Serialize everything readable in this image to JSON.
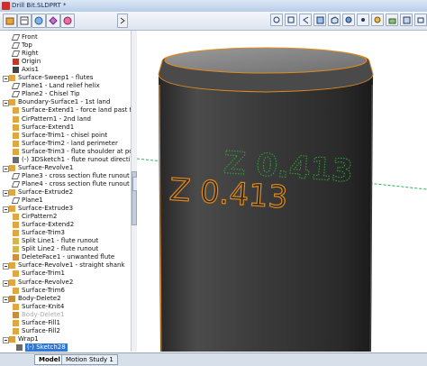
{
  "window": {
    "title": "Drill Bit.SLDPRT *"
  },
  "tree": {
    "items": [
      {
        "label": "Front",
        "icon": "plane-icon",
        "kind": "plane",
        "indent": 1
      },
      {
        "label": "Top",
        "icon": "plane-icon",
        "kind": "plane",
        "indent": 1
      },
      {
        "label": "Right",
        "icon": "plane-icon",
        "kind": "plane",
        "indent": 1
      },
      {
        "label": "Origin",
        "icon": "origin-icon",
        "kind": "origin",
        "indent": 1
      },
      {
        "label": "Axis1",
        "icon": "axis-icon",
        "kind": "axis",
        "indent": 1
      },
      {
        "label": "Surface-Sweep1 - flutes",
        "icon": "surface-feature-icon",
        "kind": "surface",
        "indent": 0,
        "exp": true
      },
      {
        "label": "Plane1 - Land relief helix",
        "icon": "plane-icon",
        "kind": "plane",
        "indent": 1
      },
      {
        "label": "Plane2 - Chisel Tip",
        "icon": "plane-icon",
        "kind": "plane",
        "indent": 1
      },
      {
        "label": "Boundary-Surface1 - 1st land",
        "icon": "surface-feature-icon",
        "kind": "surface",
        "indent": 0,
        "exp": true
      },
      {
        "label": "Surface-Extend1 - force land past flute",
        "icon": "surface-feature-icon",
        "kind": "surface",
        "indent": 1
      },
      {
        "label": "CirPattern1 - 2nd land",
        "icon": "pattern-icon",
        "kind": "pattern",
        "indent": 1
      },
      {
        "label": "Surface-Extend1",
        "icon": "surface-feature-icon",
        "kind": "surface",
        "indent": 1
      },
      {
        "label": "Surface-Trim1 - chisel point",
        "icon": "surface-feature-icon",
        "kind": "surface",
        "indent": 1
      },
      {
        "label": "Surface-Trim2 - land perimeter",
        "icon": "surface-feature-icon",
        "kind": "surface",
        "indent": 1
      },
      {
        "label": "Surface-Trim3 - flute shoulder at point",
        "icon": "surface-feature-icon",
        "kind": "surface",
        "indent": 1
      },
      {
        "label": "(-) 3DSketch1 - flute runout direction",
        "icon": "sketch-icon",
        "kind": "sketch",
        "indent": 1
      },
      {
        "label": "Surface-Revolve1",
        "icon": "surface-feature-icon",
        "kind": "surface",
        "indent": 0,
        "exp": true
      },
      {
        "label": "Plane3 - cross section flute runout",
        "icon": "plane-icon",
        "kind": "plane",
        "indent": 1
      },
      {
        "label": "Plane4 - cross section flute runout",
        "icon": "plane-icon",
        "kind": "plane",
        "indent": 1
      },
      {
        "label": "Surface-Extrude2",
        "icon": "surface-feature-icon",
        "kind": "surface",
        "indent": 0,
        "exp": true
      },
      {
        "label": "Plane1",
        "icon": "plane-icon",
        "kind": "plane",
        "indent": 1
      },
      {
        "label": "Surface-Extrude3",
        "icon": "surface-feature-icon",
        "kind": "surface",
        "indent": 0,
        "exp": true
      },
      {
        "label": "CirPattern2",
        "icon": "pattern-icon",
        "kind": "pattern",
        "indent": 1
      },
      {
        "label": "Surface-Extend2",
        "icon": "surface-feature-icon",
        "kind": "surface",
        "indent": 1
      },
      {
        "label": "Surface-Trim3",
        "icon": "surface-feature-icon",
        "kind": "surface",
        "indent": 1
      },
      {
        "label": "Split Line1 - flute runout",
        "icon": "split-line-icon",
        "kind": "split",
        "indent": 1
      },
      {
        "label": "Split Line2 - flute runout",
        "icon": "split-line-icon",
        "kind": "split",
        "indent": 1
      },
      {
        "label": "DeleteFace1 - unwanted flute",
        "icon": "delete-face-icon",
        "kind": "face",
        "indent": 1
      },
      {
        "label": "Surface-Revolve1 - straight shank",
        "icon": "surface-feature-icon",
        "kind": "surface",
        "indent": 0,
        "exp": true
      },
      {
        "label": "Surface-Trim1",
        "icon": "surface-feature-icon",
        "kind": "surface",
        "indent": 1
      },
      {
        "label": "Surface-Revolve2",
        "icon": "surface-feature-icon",
        "kind": "surface",
        "indent": 0,
        "exp": true
      },
      {
        "label": "Surface-Trim6",
        "icon": "surface-feature-icon",
        "kind": "surface",
        "indent": 1
      },
      {
        "label": "Body-Delete2",
        "icon": "body-delete-icon",
        "kind": "body",
        "indent": 0,
        "exp": true
      },
      {
        "label": "Surface-Knit4",
        "icon": "surface-feature-icon",
        "kind": "surface",
        "indent": 1
      },
      {
        "label": "Body-Delete1",
        "icon": "body-delete-icon",
        "kind": "body",
        "indent": 1,
        "dim": true
      },
      {
        "label": "Surface-Fill1",
        "icon": "surface-feature-icon",
        "kind": "surface",
        "indent": 1
      },
      {
        "label": "Surface-Fill2",
        "icon": "surface-feature-icon",
        "kind": "surface",
        "indent": 1
      },
      {
        "label": "Wrap1",
        "icon": "wrap-icon",
        "kind": "wrap",
        "indent": 0,
        "exp": true
      },
      {
        "label": "(-) Sketch28",
        "icon": "sketch-icon",
        "kind": "sketch",
        "indent": 2,
        "selected": true
      }
    ]
  },
  "tabs": [
    {
      "label": "Model",
      "active": true
    },
    {
      "label": "Motion Study 1",
      "active": false
    }
  ],
  "viewport": {
    "engraved_text": "Z 0.413",
    "sketch_text": "Z 0.413",
    "colors": {
      "body": "#3a3a3a",
      "edge_highlight": "#e08a1e",
      "sketch": "#2e9e3a",
      "axis_line": "#2cb35a"
    }
  }
}
